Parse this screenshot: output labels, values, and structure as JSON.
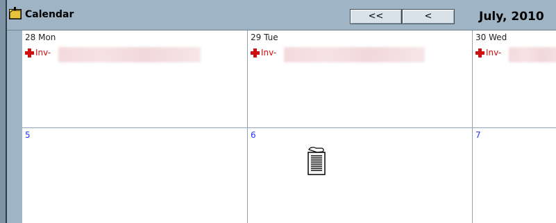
{
  "window": {
    "title": "Calendar",
    "icon": "folder-calendar-icon"
  },
  "navigation": {
    "prev_year_label": "<<",
    "prev_month_label": "<",
    "month_label": "July, 2010"
  },
  "weeks": [
    {
      "days": [
        {
          "label": "28 Mon",
          "events": [
            {
              "text": "Inv-",
              "icon": "red-cross-icon"
            }
          ]
        },
        {
          "label": "29 Tue",
          "events": [
            {
              "text": "Inv-",
              "icon": "red-cross-icon"
            }
          ]
        },
        {
          "label": "30 Wed",
          "events": [
            {
              "text": "Inv-",
              "icon": "red-cross-icon"
            }
          ]
        }
      ]
    },
    {
      "days": [
        {
          "label": "5",
          "events": []
        },
        {
          "label": "6",
          "events": []
        },
        {
          "label": "7",
          "events": []
        }
      ]
    }
  ],
  "colors": {
    "frame": "#9fb4c4",
    "grid_line": "#8ca1b4",
    "event_red": "#d01010",
    "date_blue": "#2233ff"
  },
  "cursor": "drag-document-icon"
}
